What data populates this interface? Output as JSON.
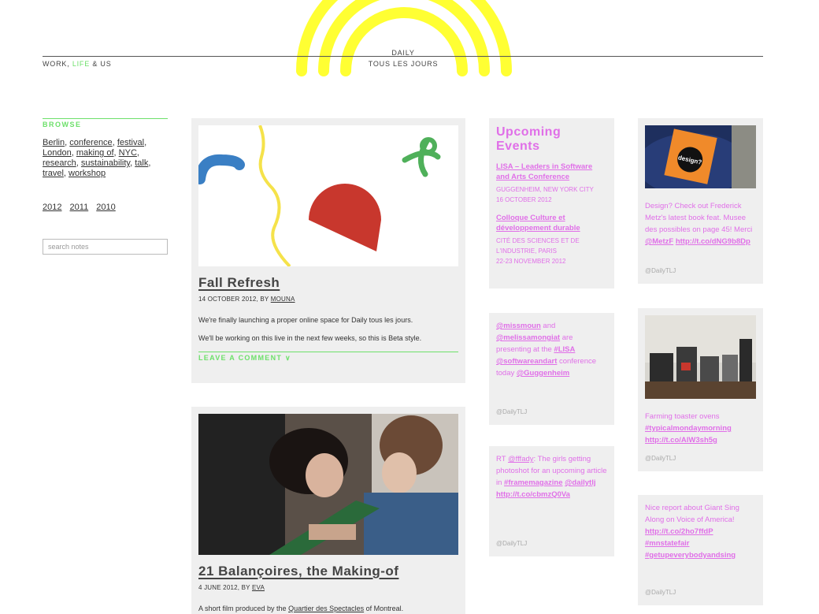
{
  "header": {
    "tagline_pre": "WORK, ",
    "tagline_accent": "LIFE",
    "tagline_post": " & US",
    "logo_line1": "DAILY",
    "logo_line2": "TOUS LES JOURS",
    "accent_color": "#6de06a",
    "arch_color": "#ffff33"
  },
  "sidebar": {
    "browse_label": "BROWSE",
    "tags": [
      "Berlin",
      "conference",
      "festival",
      "London",
      "making of",
      "NYC",
      "research",
      "sustainability",
      "talk",
      "travel",
      "workshop"
    ],
    "years": [
      "2012",
      "2011",
      "2010"
    ],
    "search_placeholder": "search notes"
  },
  "posts": [
    {
      "title": "Fall Refresh",
      "date": "14 OCTOBER 2012, BY ",
      "author": "MOUNA",
      "body": [
        "We're finally launching a proper online space for Daily tous les jours.",
        "We'll be working on this live in the next few weeks, so this is Beta style."
      ],
      "comment_label": "LEAVE A COMMENT"
    },
    {
      "title": "21 Balançoires, the Making-of",
      "date": "4 JUNE 2012, BY ",
      "author": "EVA",
      "body_pre": "A short film produced by the ",
      "body_link": "Quartier des Spectacles",
      "body_post": " of Montreal."
    }
  ],
  "events": {
    "title_line1": "Upcoming",
    "title_line2": "Events",
    "items": [
      {
        "name": "LISA – Leaders in Software and Arts Conference",
        "location": "GUGGENHEIM, NEW YORK CITY",
        "date": "16 OCTOBER 2012"
      },
      {
        "name": "Colloque Culture et développement durable",
        "location": "CITÉ DES SCIENCES ET DE L'INDUSTRIE, PARIS",
        "date": "22-23 NOVEMBER 2012"
      }
    ],
    "color": "#e06fe8"
  },
  "tweets": {
    "source": "@DailyTLJ",
    "t1": {
      "m1": "@missmoun",
      "w1": " and ",
      "m2": "@melissamongiat",
      "w2": " are presenting at the ",
      "m3": "#LISA",
      "w3": " ",
      "m4": "@softwareandart",
      "w4": " conference today ",
      "m5": "@Guggenheim"
    },
    "t2": {
      "w1": "RT ",
      "m1": "@fffady",
      "w2": ": The girls getting photoshot for an upcoming article in ",
      "m2": "#framemagazine",
      "w3": " ",
      "m3": "@dailytlj",
      "w4": " ",
      "m4": "http://t.co/cbmzQ0Va"
    },
    "t3": {
      "w1": "Design? Check out Frederick Metz's latest book feat. Musee des possibles on page 45! Merci ",
      "m1": "@MetzF",
      "w2": " ",
      "m2": "http://t.co/dNG9b8Dp"
    },
    "t4": {
      "w1": "Farming toaster ovens ",
      "m1": "#typicalmondaymorning",
      "w2": " ",
      "m2": "http://t.co/AlW3sh5g"
    },
    "t5": {
      "w1": "Nice report about Giant Sing Along on Voice of America! ",
      "m1": "http://t.co/2ho7ffdP",
      "w2": " ",
      "m2": "#mnstatefair",
      "w3": " ",
      "m3": "#getupeverybodyandsing"
    }
  }
}
